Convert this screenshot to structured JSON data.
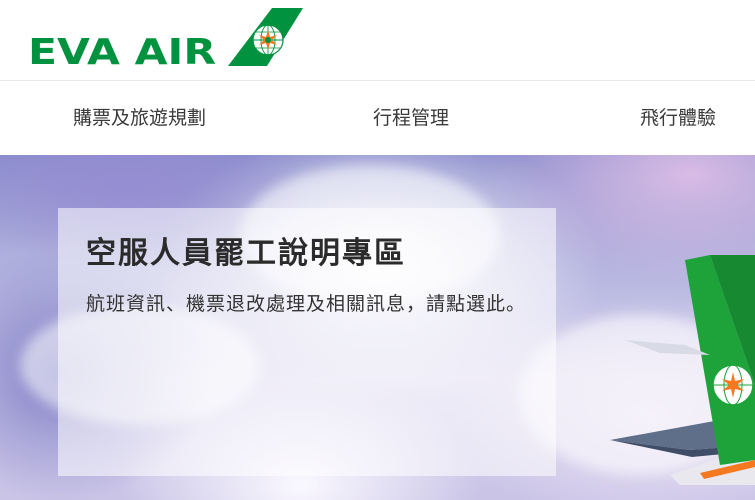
{
  "brand": {
    "logo_text": "EVA AIR",
    "primary_color": "#00923f",
    "accent_color": "#f47920"
  },
  "nav": {
    "items": [
      {
        "label": "購票及旅遊規劃"
      },
      {
        "label": "行程管理"
      },
      {
        "label": "飛行體驗"
      }
    ]
  },
  "hero": {
    "notice": {
      "title": "空服人員罷工說明專區",
      "body": "航班資訊、機票退改處理及相關訊息，請點選此。"
    }
  }
}
